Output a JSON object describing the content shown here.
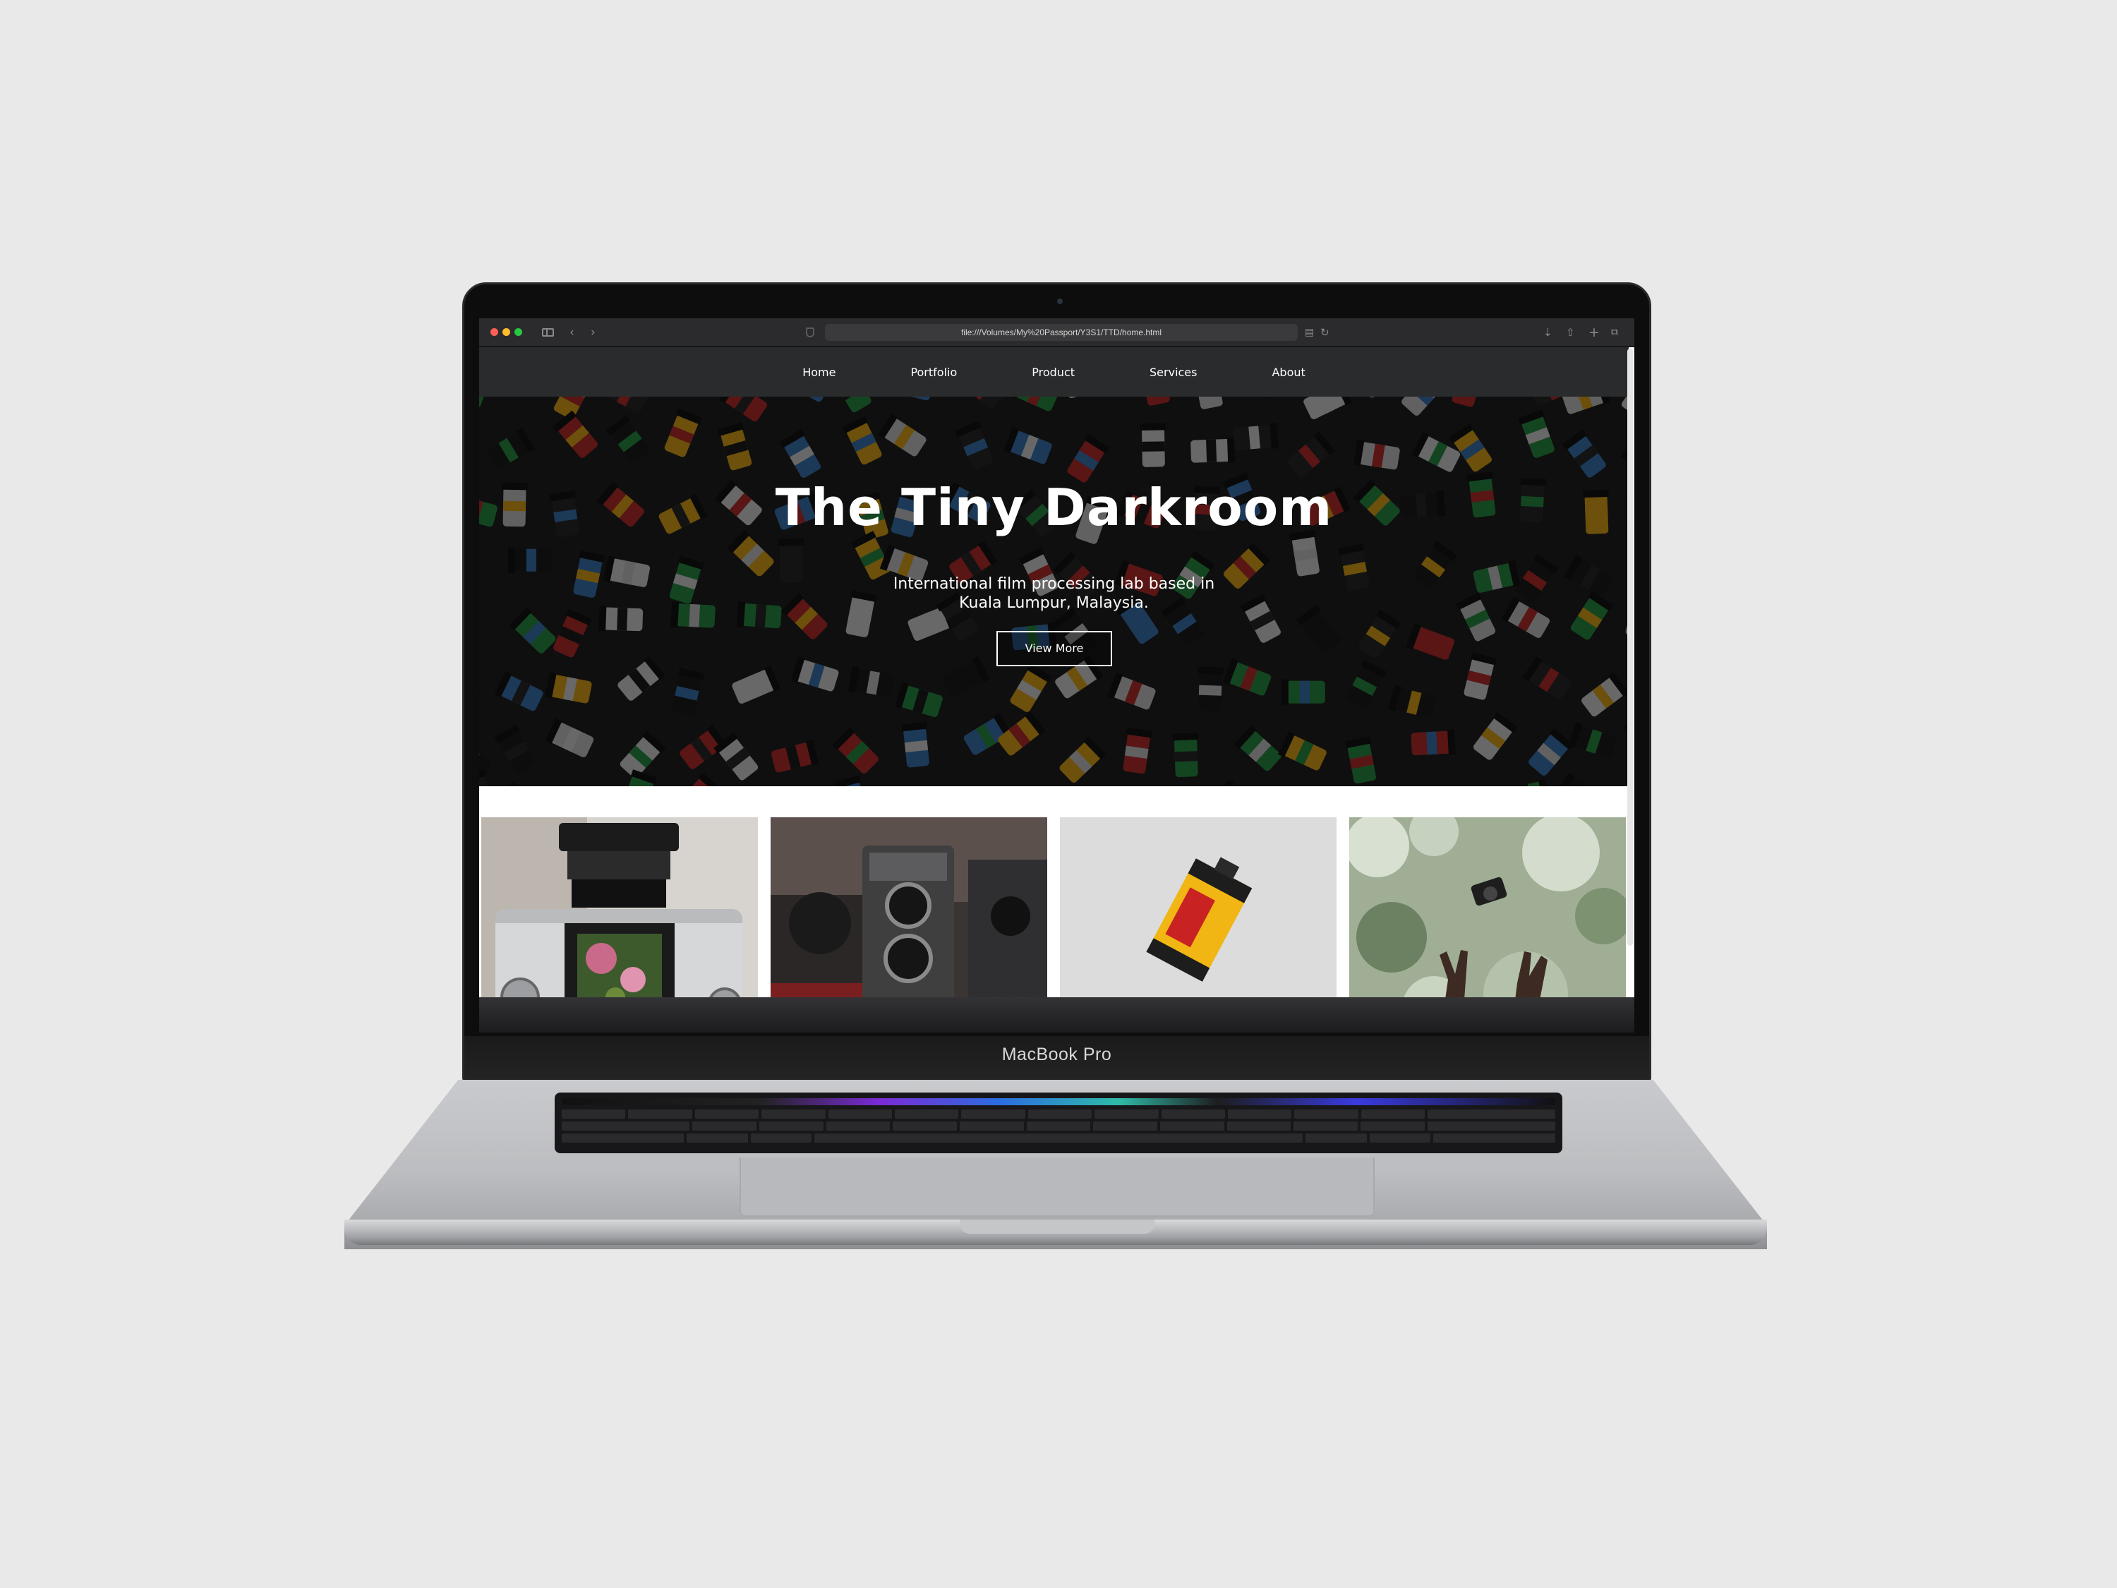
{
  "device": {
    "brand_label": "MacBook Pro"
  },
  "browser": {
    "address": "file:///Volumes/My%20Passport/Y3S1/TTD/home.html"
  },
  "site": {
    "nav": [
      {
        "label": "Home"
      },
      {
        "label": "Portfolio"
      },
      {
        "label": "Product"
      },
      {
        "label": "Services"
      },
      {
        "label": "About"
      }
    ],
    "hero": {
      "title": "The Tiny Darkroom",
      "subtitle_line1": "International film processing lab based in",
      "subtitle_line2": "Kuala Lumpur, Malaysia.",
      "button_label": "View More"
    },
    "gallery": [
      {
        "icon": "medium-format-camera-photo"
      },
      {
        "icon": "twin-lens-reflex-camera-photo"
      },
      {
        "icon": "kodak-film-canister-photo"
      },
      {
        "icon": "hands-tossing-camera-photo"
      }
    ]
  },
  "colors": {
    "page_bg": "#e9e9e9",
    "nav_bg": "#2a2b2d",
    "hero_text": "#ffffff",
    "traffic_red": "#fe5f57",
    "traffic_yellow": "#febc2e",
    "traffic_green": "#28c840"
  }
}
